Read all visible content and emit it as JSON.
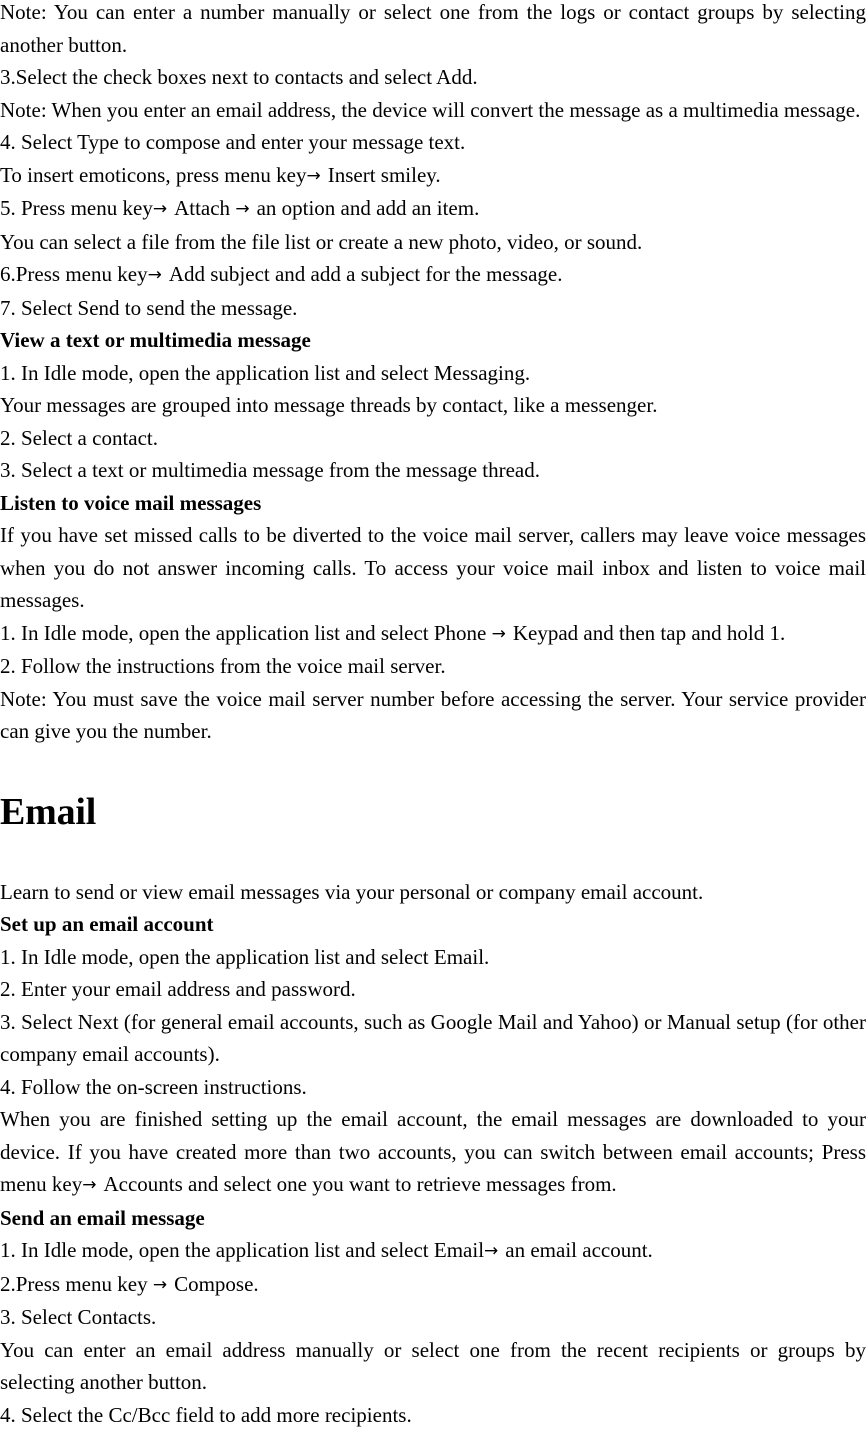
{
  "document": {
    "arrow_glyph": "→",
    "text_color": "#000000",
    "background_color": "#ffffff",
    "blocks": [
      {
        "id": "note-enter-number",
        "type": "paragraph-justified",
        "text": "Note: You can enter a number manually or select one from the logs or contact groups by selecting another button."
      },
      {
        "id": "step-3-check-boxes",
        "type": "line",
        "text": "3.Select the check boxes next to contacts and select Add."
      },
      {
        "id": "note-email-address-mms",
        "type": "paragraph-justified",
        "text": "Note: When you enter an email address, the device will convert the message as a multimedia message."
      },
      {
        "id": "step-4-select-type",
        "type": "line",
        "text": "4. Select Type to compose and enter your message text."
      },
      {
        "id": "insert-emoticons",
        "type": "line-with-arrows",
        "segments": [
          "To insert emoticons, press menu key",
          "Insert smiley."
        ]
      },
      {
        "id": "step-5-attach",
        "type": "line-with-arrows",
        "segments": [
          "5. Press menu key",
          "Attach ",
          "an option and add an item."
        ]
      },
      {
        "id": "select-file-note",
        "type": "line",
        "text": "You can select a file from the file list or create a new photo, video, or sound."
      },
      {
        "id": "step-6-add-subject",
        "type": "line-with-arrows",
        "segments": [
          "6.Press menu key",
          "Add subject and add a subject for the message."
        ]
      },
      {
        "id": "step-7-send",
        "type": "line",
        "text": "7. Select Send to send the message."
      },
      {
        "id": "heading-view-message",
        "type": "subheading",
        "text": "View a text or multimedia message"
      },
      {
        "id": "view-step-1",
        "type": "line",
        "text": "1. In Idle mode, open the application list and select Messaging."
      },
      {
        "id": "view-note-threads",
        "type": "line",
        "text": "Your messages are grouped into message threads by contact, like a messenger."
      },
      {
        "id": "view-step-2",
        "type": "line",
        "text": "2. Select a contact."
      },
      {
        "id": "view-step-3",
        "type": "line",
        "text": "3. Select a text or multimedia message from the message thread."
      },
      {
        "id": "heading-listen-voicemail",
        "type": "subheading",
        "text": "Listen to voice mail messages"
      },
      {
        "id": "voicemail-intro",
        "type": "paragraph-justified",
        "text": "If you have set missed calls to be diverted to the voice mail server, callers may leave voice messages when you do not answer incoming calls. To access your voice mail inbox and listen to voice mail messages."
      },
      {
        "id": "voicemail-step-1",
        "type": "line-with-arrows",
        "segments": [
          "1. In Idle mode, open the application list and select Phone ",
          "Keypad and then tap and hold 1."
        ]
      },
      {
        "id": "voicemail-step-2",
        "type": "line",
        "text": "2. Follow the instructions from the voice mail server."
      },
      {
        "id": "voicemail-note",
        "type": "paragraph-justified",
        "text": "Note: You must save the voice mail server number before accessing the server. Your service provider can give you the number."
      },
      {
        "id": "section-email",
        "type": "section-heading",
        "text": "Email"
      },
      {
        "id": "email-intro",
        "type": "line",
        "text": "Learn to send or view email messages via your personal or company email account."
      },
      {
        "id": "heading-set-up-email",
        "type": "subheading",
        "text": "Set up an email account"
      },
      {
        "id": "setup-step-1",
        "type": "line",
        "text": "1. In Idle mode, open the application list and select Email."
      },
      {
        "id": "setup-step-2",
        "type": "line",
        "text": "2. Enter your email address and password."
      },
      {
        "id": "setup-step-3",
        "type": "paragraph-justified",
        "text": "3. Select Next (for general email accounts, such as Google Mail and Yahoo) or Manual setup (for other company email accounts)."
      },
      {
        "id": "setup-step-4",
        "type": "line",
        "text": "4. Follow the on-screen instructions."
      },
      {
        "id": "setup-finished-note",
        "type": "paragraph-justified-arrow",
        "segments": [
          "When you are finished setting up the email account, the email messages are downloaded to your device. If you have created more than two accounts, you can switch between email accounts; Press menu key",
          "Accounts and select one you want to retrieve messages from."
        ]
      },
      {
        "id": "heading-send-email",
        "type": "subheading",
        "text": "Send an email message"
      },
      {
        "id": "send-step-1",
        "type": "line-with-arrows",
        "segments": [
          "1. In Idle mode, open the application list and select Email",
          "an email account."
        ]
      },
      {
        "id": "send-step-2",
        "type": "line-with-arrows",
        "segments": [
          "2.Press menu key ",
          "Compose."
        ]
      },
      {
        "id": "send-step-3",
        "type": "line",
        "text": "3. Select Contacts."
      },
      {
        "id": "send-note-recipients",
        "type": "paragraph-justified",
        "text": "You can enter an email address manually or select one from the recent recipients or groups by selecting another button."
      },
      {
        "id": "send-step-4",
        "type": "line",
        "text": "4. Select the Cc/Bcc field to add more recipients."
      }
    ]
  }
}
